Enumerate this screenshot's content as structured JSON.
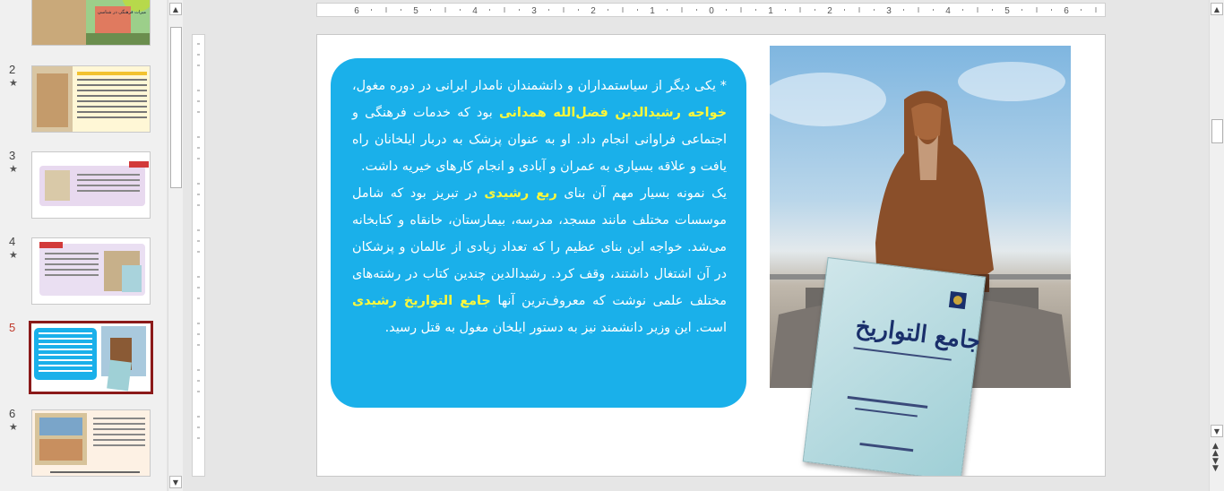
{
  "thumbnails": [
    {
      "number": "",
      "star": "",
      "caption": "میراث فرهنگی در شناسی"
    },
    {
      "number": "2",
      "star": "★"
    },
    {
      "number": "3",
      "star": "★"
    },
    {
      "number": "4",
      "star": "★"
    },
    {
      "number": "5",
      "star": "",
      "selected": true
    },
    {
      "number": "6",
      "star": "★"
    }
  ],
  "ruler": {
    "labels": [
      "6",
      "5",
      "4",
      "3",
      "2",
      "1",
      "0",
      "1",
      "2",
      "3",
      "4",
      "5",
      "6"
    ]
  },
  "slide": {
    "paragraph1": {
      "before": "* یکی دیگر از سیاستمداران و دانشمندان نامدار ایرانی در دوره مغول، ",
      "highlight": "خواجه رشیدالدین فضل‌الله همدانی",
      "after": " بود که خدمات فرهنگی و اجتماعی فراوانی انجام داد. او به عنوان پزشک به دربار ایلخانان راه یافت و علاقه بسیاری به عمران و آبادی و انجام کارهای خیریه داشت."
    },
    "paragraph2": {
      "before": "یک نمونه بسیار مهم آن بنای ",
      "highlight1": "ربع رشیدی",
      "middle": " در تبریز بود که شامل موسسات مختلف مانند مسجد، مدرسه، بیمارستان، خانقاه و کتابخانه می‌شد. خواجه این بنای عظیم را که تعداد زیادی از عالمان و پزشکان در آن اشتغال داشتند، وقف کرد. رشیدالدین چندین کتاب در رشته‌های مختلف علمی نوشت که معروف‌ترین آنها ",
      "highlight2": "جامع التواریخ رشیدی",
      "after": " است. این وزیر دانشمند نیز به دستور ایلخان مغول به قتل رسید."
    },
    "book_title": "جامع التواریخ",
    "colors": {
      "box": "#1ab0ea",
      "highlight": "#fff83a",
      "selected_border": "#8b1a1a"
    }
  },
  "icons": [
    "scroll-up-icon",
    "scroll-down-icon",
    "prev-slide-icon",
    "next-slide-icon"
  ]
}
